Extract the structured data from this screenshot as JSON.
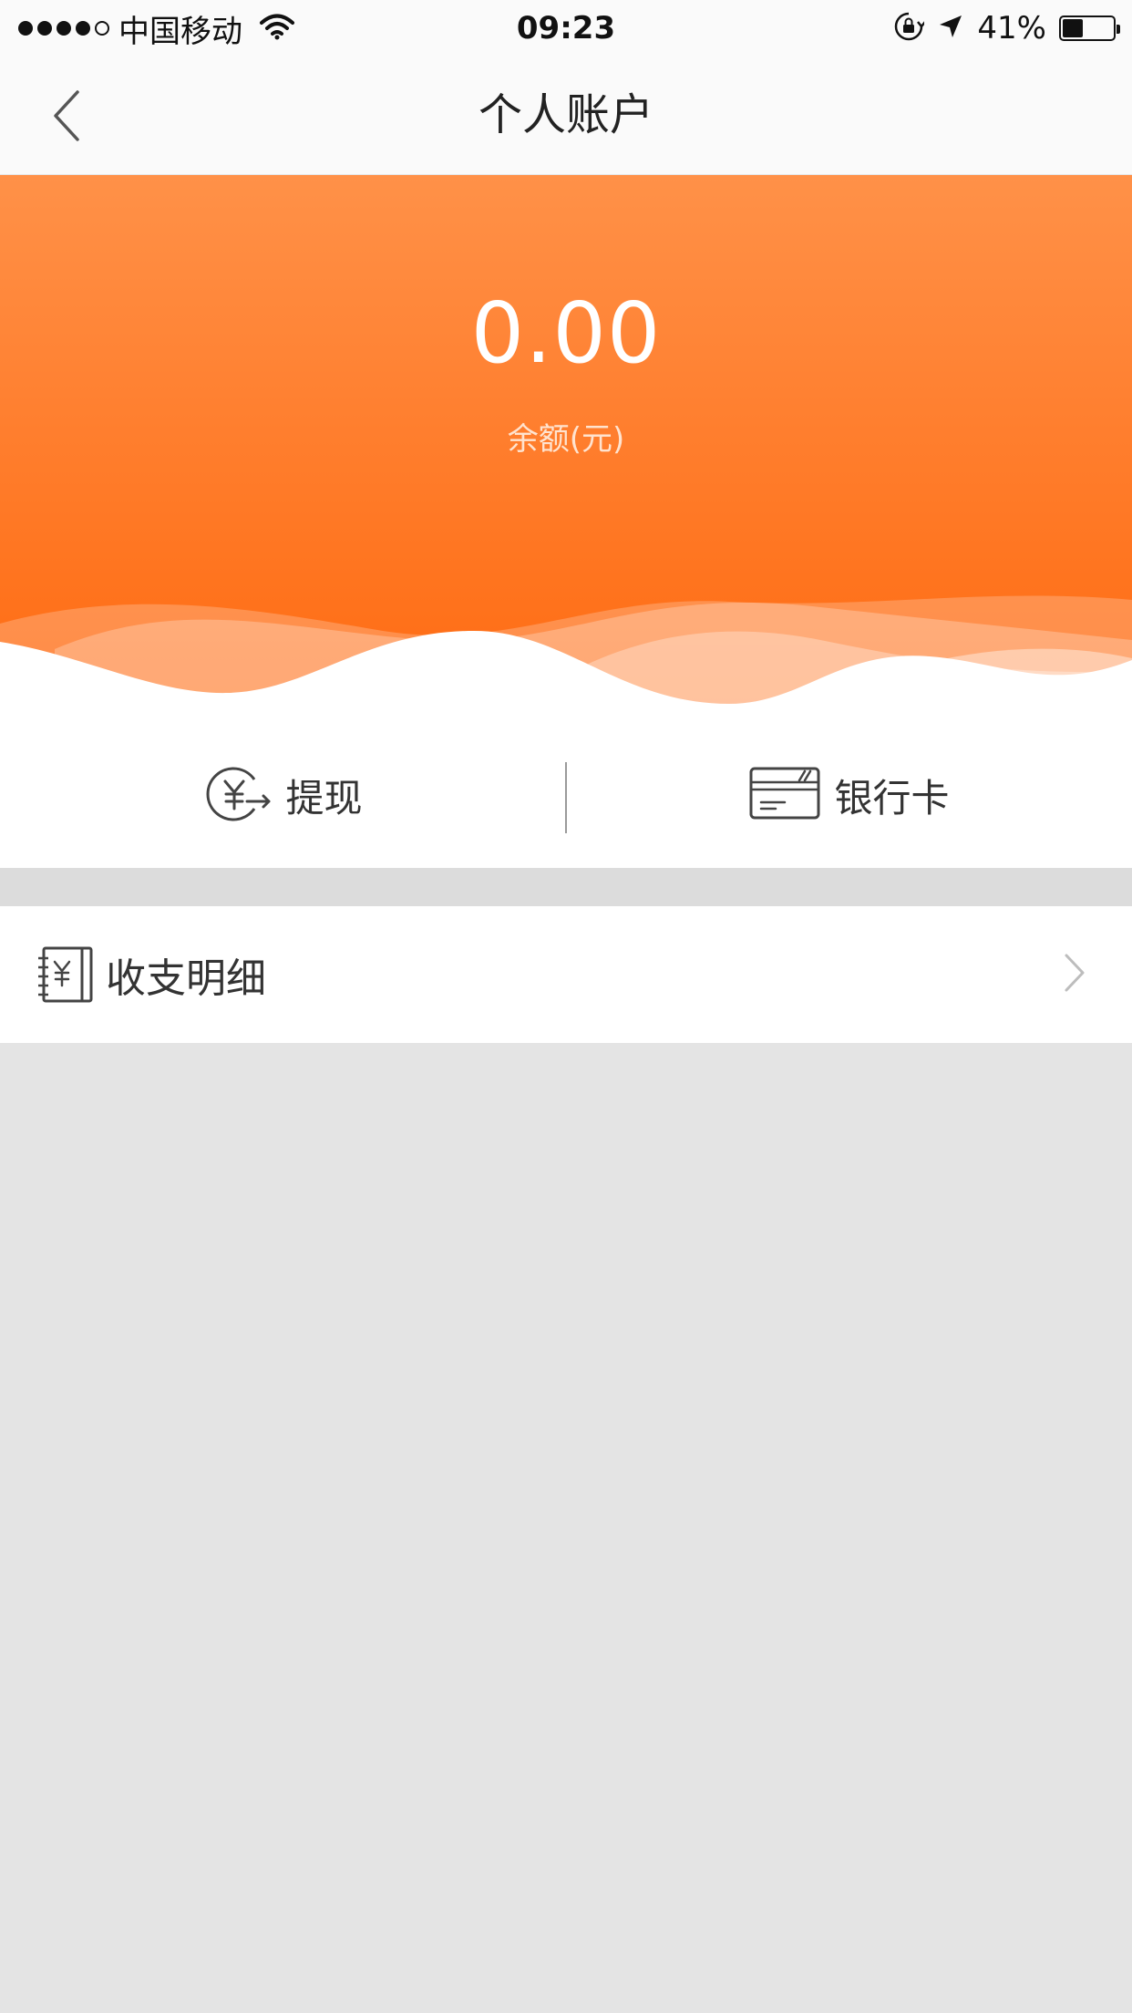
{
  "status_bar": {
    "carrier": "中国移动",
    "time": "09:23",
    "battery_percent": "41%",
    "battery_level": 0.41,
    "signal_bars_filled": 4,
    "signal_bars_total": 5
  },
  "nav": {
    "title": "个人账户",
    "back_icon": "chevron-left-icon"
  },
  "balance": {
    "amount": "0.00",
    "label": "余额(元)"
  },
  "actions": [
    {
      "label": "提现",
      "icon": "yuan-withdraw-icon"
    },
    {
      "label": "银行卡",
      "icon": "bank-card-icon"
    }
  ],
  "list": [
    {
      "label": "收支明细",
      "icon": "ledger-icon",
      "chevron_icon": "chevron-right-icon"
    }
  ],
  "colors": {
    "accent_top": "#ff9148",
    "accent_bottom": "#ff6a10",
    "background": "#e4e4e4",
    "surface": "#ffffff"
  }
}
